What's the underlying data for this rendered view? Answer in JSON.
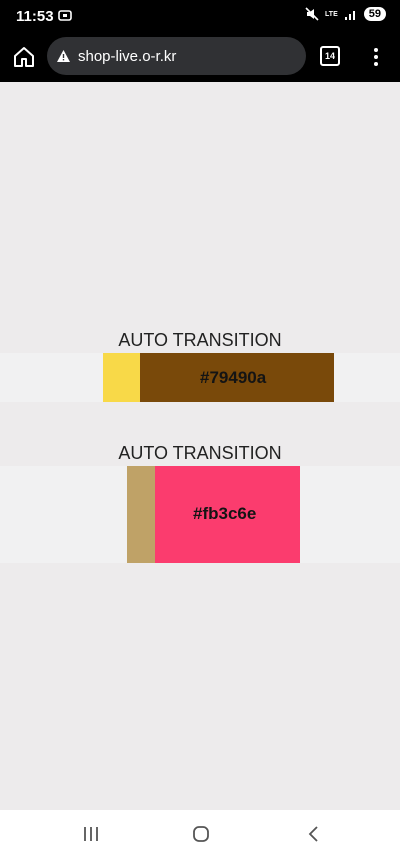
{
  "status_bar": {
    "time": "11:53",
    "network": "LTE",
    "battery": "59"
  },
  "browser": {
    "url": "shop-live.o-r.kr",
    "tab_count": "14"
  },
  "sections": [
    {
      "title": "AUTO TRANSITION",
      "accent_color": "#f8d948",
      "main_color": "#79490a",
      "label": "#79490a"
    },
    {
      "title": "AUTO TRANSITION",
      "accent_color": "#bfa267",
      "main_color": "#fb3c6e",
      "label": "#fb3c6e"
    }
  ],
  "icons": {
    "home": "home-icon",
    "warning": "warning-icon",
    "menu": "menu-icon",
    "recent_apps": "recent-apps-icon",
    "home_nav": "home-nav-icon",
    "back": "back-icon"
  }
}
